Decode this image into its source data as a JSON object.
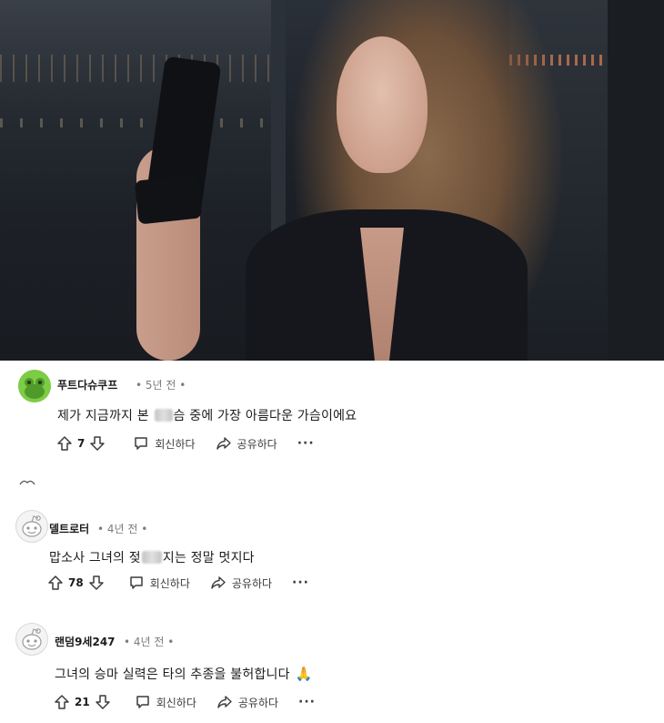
{
  "media": {
    "alt_icon": "video-frame"
  },
  "comments": [
    {
      "username": "푸트다슈쿠프",
      "time": "5년 전",
      "text_before": "제가 지금까지 본 ",
      "text_hidden": "",
      "text_after": "슴 중에 가장 아름다운 가슴이에요",
      "votes": "7",
      "reply_label": "회신하다",
      "share_label": "공유하다",
      "more_label": "···"
    },
    {
      "username": "델트로터",
      "time": "4년 전",
      "text_before": "맙소사 그녀의 젖",
      "text_hidden": "",
      "text_after": "지는 정말 멋지다",
      "votes": "78",
      "reply_label": "회신하다",
      "share_label": "공유하다",
      "more_label": "···"
    },
    {
      "username": "랜덤9세247",
      "time": "4년 전",
      "text_before": "그녀의 승마 실력은 타의 추종을 불허합니다",
      "text_hidden": "",
      "text_after": "",
      "emoji": "🙏",
      "votes": "21",
      "reply_label": "회신하다",
      "share_label": "공유하다",
      "more_label": "···"
    }
  ],
  "separator": "•",
  "colors": {
    "avatar_green": "#7ccc45",
    "text_primary": "#1c1c1c",
    "text_meta": "#7c7c7c"
  }
}
